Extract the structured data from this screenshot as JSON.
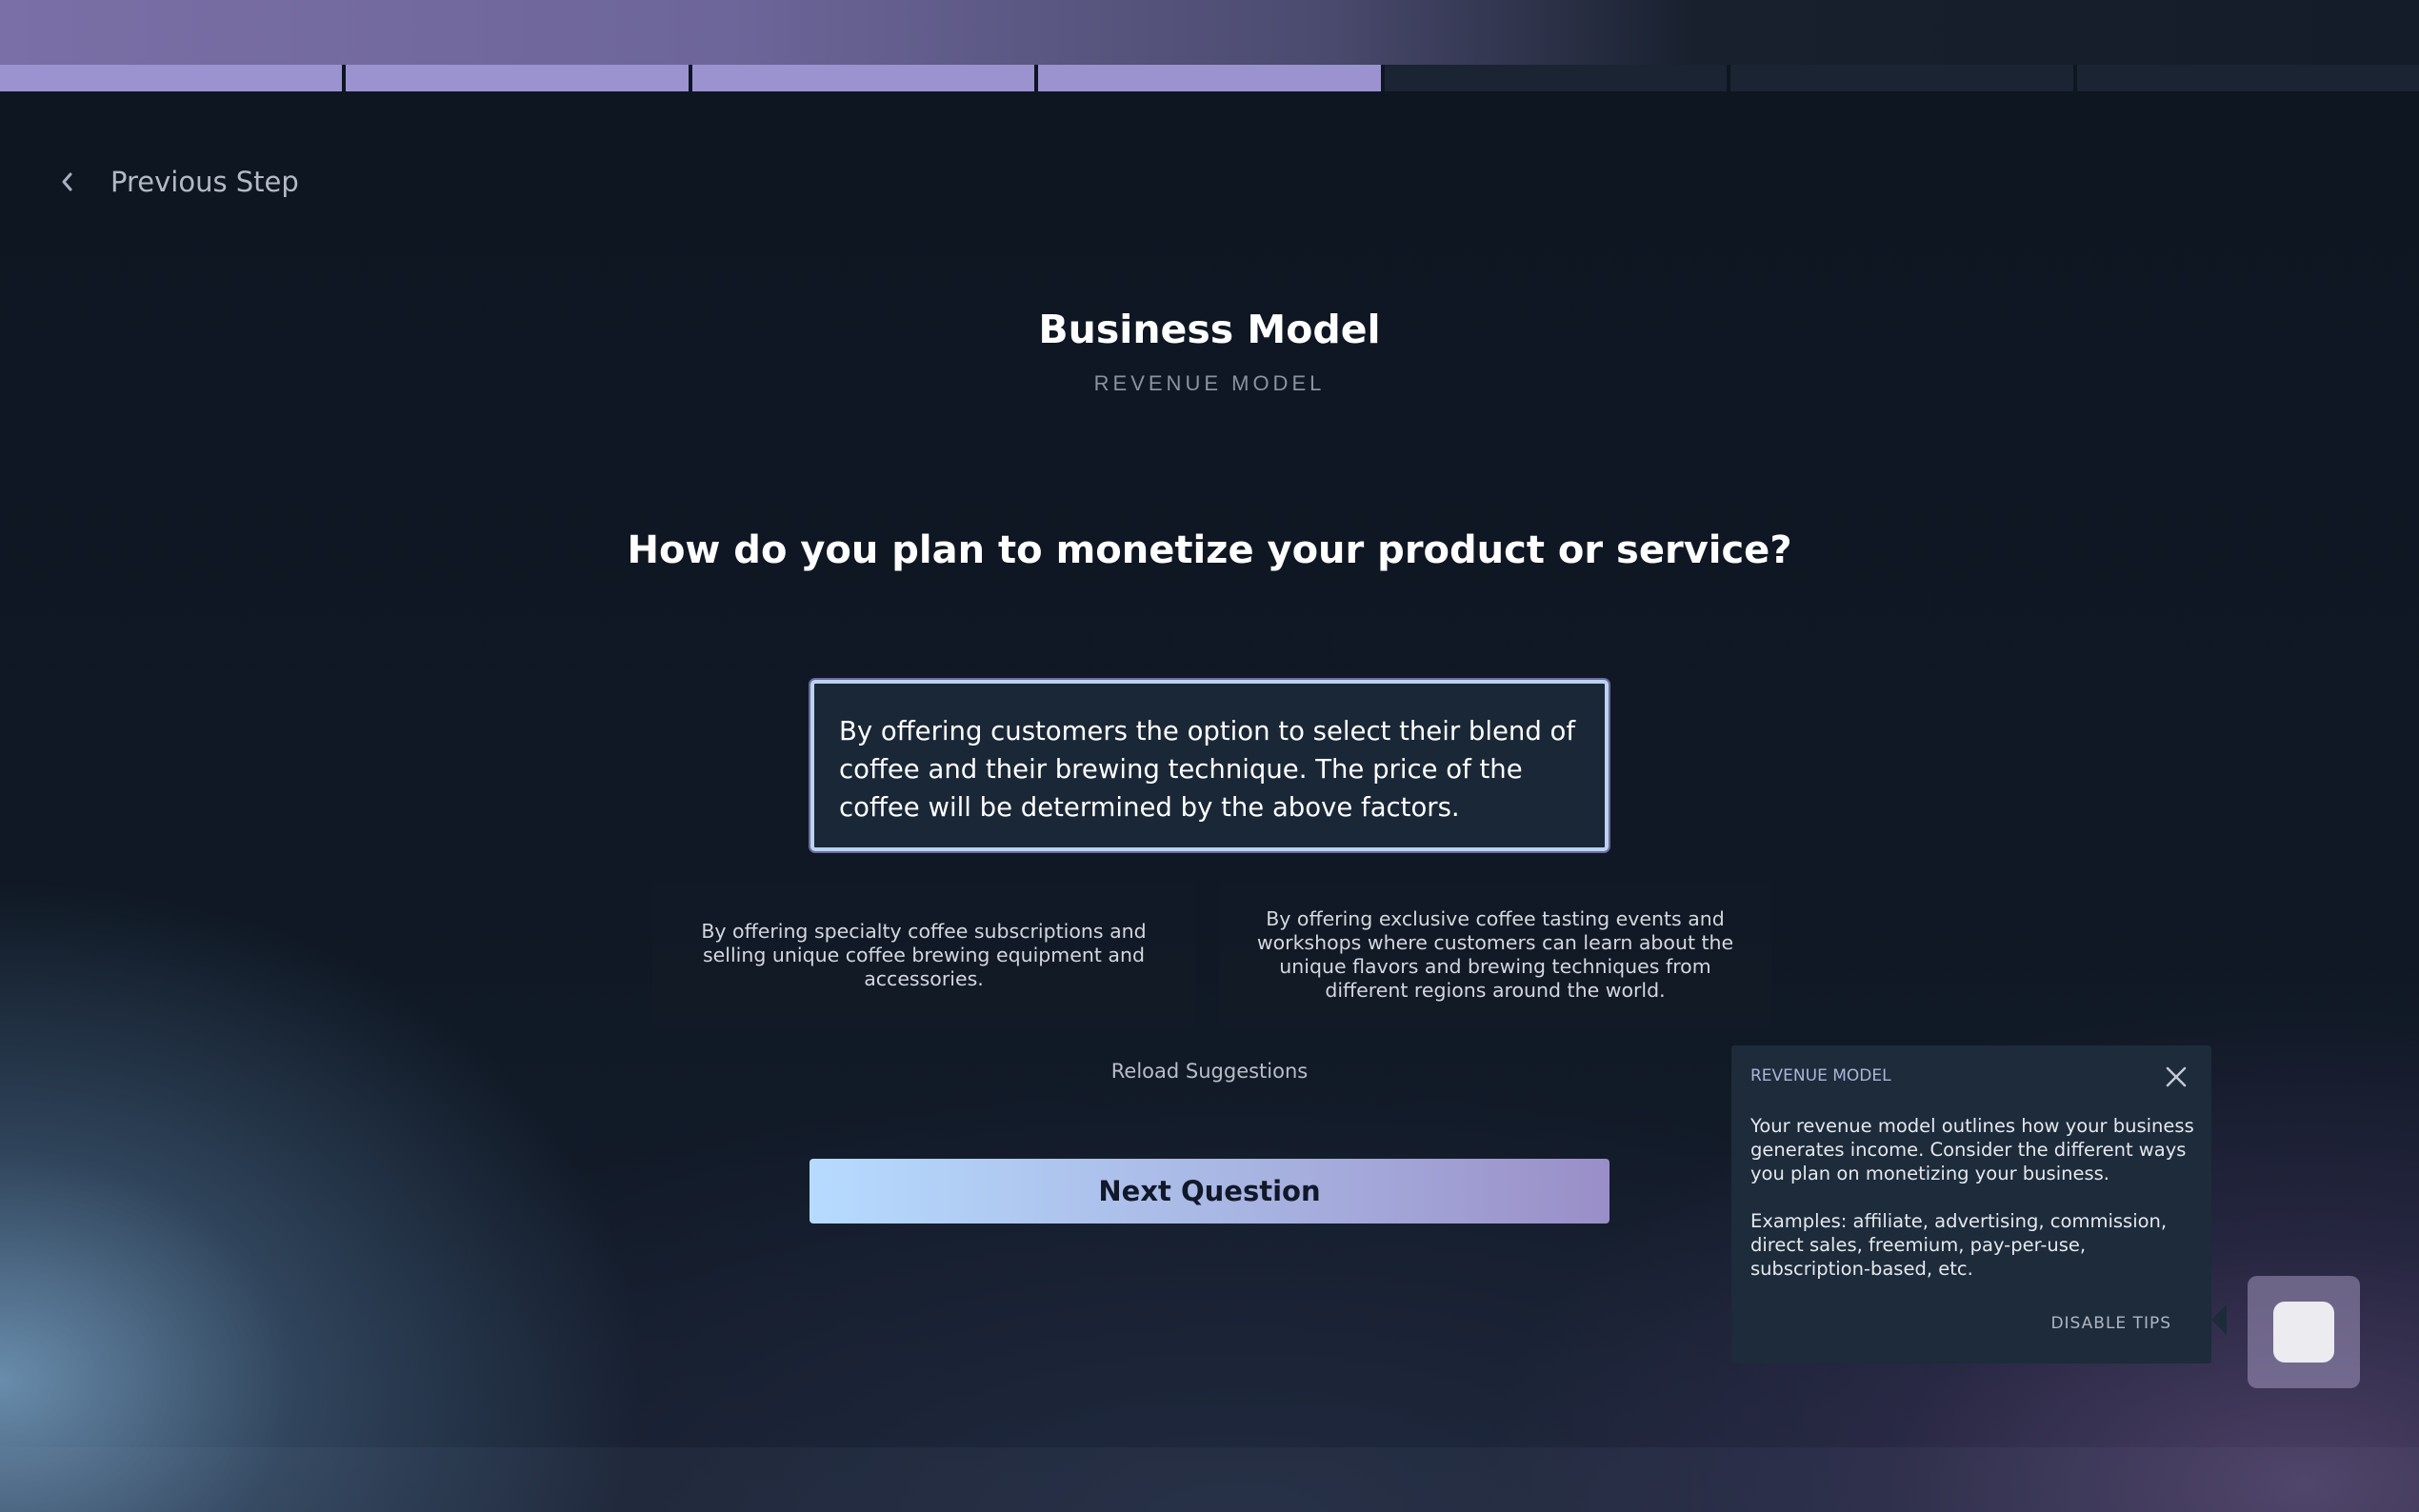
{
  "progress": {
    "total_steps": 7,
    "completed_steps": 4
  },
  "nav": {
    "previous_label": "Previous Step"
  },
  "header": {
    "title": "Business Model",
    "subtitle": "REVENUE MODEL"
  },
  "question": {
    "text": "How do you plan to monetize your product or service?",
    "answer": "By offering customers the option to select their blend of coffee and their brewing technique. The price of the coffee will be determined by the above factors."
  },
  "suggestions": [
    "By offering specialty coffee subscriptions and selling unique coffee brewing equipment and accessories.",
    "By offering exclusive coffee tasting events and workshops where customers can learn about the unique flavors and brewing techniques from different regions around the world."
  ],
  "actions": {
    "reload_label": "Reload Suggestions",
    "next_label": "Next Question"
  },
  "tip": {
    "heading": "REVENUE MODEL",
    "paragraph_1": "Your revenue model outlines how your business generates income. Consider the different ways you plan on monetizing your business.",
    "paragraph_2": "Examples: affiliate, advertising, commission, direct sales, freemium, pay-per-use, subscription-based, etc.",
    "disable_label": "DISABLE TIPS"
  },
  "icons": {
    "back": "chevron-left-icon",
    "close": "close-icon",
    "assistant": "assistant-icon"
  },
  "colors": {
    "background": "#0e1622",
    "progress_done": "#9a93d0",
    "progress_todo": "#1a2433",
    "accent_border": "#b9d3f0",
    "button_gradient_start": "#b6dbff",
    "button_gradient_end": "#9a8ec8",
    "tip_background": "#1d2b3b"
  }
}
